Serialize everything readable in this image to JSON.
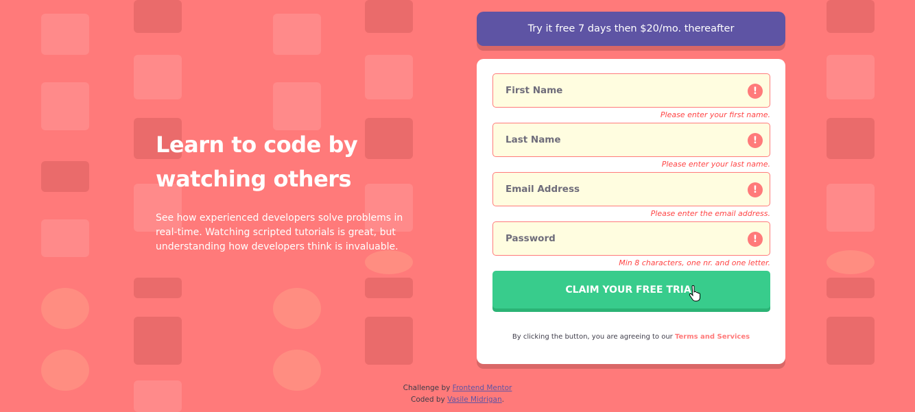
{
  "banner": {
    "text": "Try it free 7 days then $20/mo. thereafter"
  },
  "hero": {
    "title_line1": "Learn to code by",
    "title_line2": "watching others",
    "description": "See how experienced developers solve problems in real-time. Watching scripted tutorials is great, but understanding how developers think is invaluable."
  },
  "form": {
    "fields": [
      {
        "placeholder": "First Name",
        "value": "",
        "error": "Please enter your first name."
      },
      {
        "placeholder": "Last Name",
        "value": "",
        "error": "Please enter your last name."
      },
      {
        "placeholder": "Email Address",
        "value": "",
        "error": "Please enter the email address."
      },
      {
        "placeholder": "Password",
        "value": "",
        "error": "Min 8 characters, one nr. and one letter."
      }
    ],
    "error_icon": "!",
    "submit_label": "CLAIM YOUR FREE TRIAL",
    "terms_prefix": "By clicking the button, you are agreeing to our",
    "terms_link": "Terms and Services"
  },
  "footer": {
    "challenge_prefix": "Challenge by",
    "challenge_link": "Frontend Mentor",
    "coded_prefix": "Coded by",
    "coded_link": "Vasile Midrigan",
    "coded_suffix": "."
  },
  "colors": {
    "background": "#ff7a7a",
    "banner": "#5e54a4",
    "cta": "#38cc8c",
    "input_bg": "#fffde0",
    "error": "#ff4444"
  }
}
